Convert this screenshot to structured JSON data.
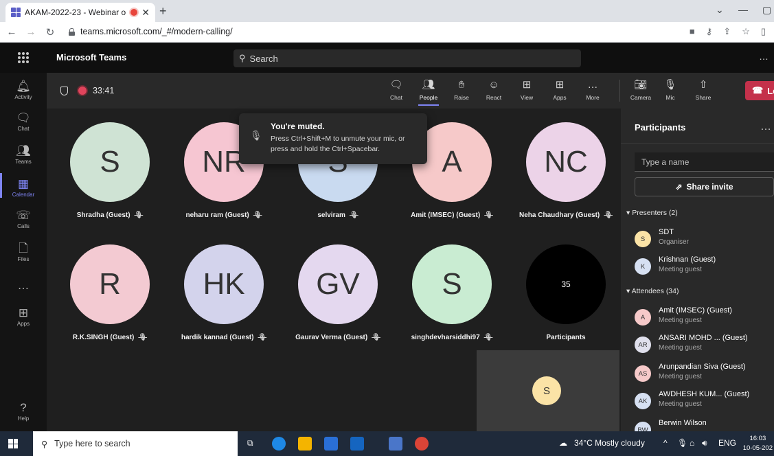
{
  "browser": {
    "tab_title": "AKAM-2022-23 - Webinar o",
    "tab_close": "✕",
    "new_tab": "+",
    "url": "teams.microsoft.com/_#/modern-calling/"
  },
  "teams": {
    "app_name": "Microsoft Teams",
    "search_placeholder": "Search"
  },
  "rail": [
    {
      "label": "Activity",
      "icon": "bell-icon",
      "glyph": "🔔︎"
    },
    {
      "label": "Chat",
      "icon": "chat-icon",
      "glyph": "🗨︎"
    },
    {
      "label": "Teams",
      "icon": "teams-icon",
      "glyph": "👥︎"
    },
    {
      "label": "Calendar",
      "icon": "calendar-icon",
      "glyph": "▦",
      "active": true
    },
    {
      "label": "Calls",
      "icon": "phone-icon",
      "glyph": "☏"
    },
    {
      "label": "Files",
      "icon": "file-icon",
      "glyph": "🗋"
    },
    {
      "label": "",
      "icon": "more-icon",
      "glyph": "…"
    },
    {
      "label": "Apps",
      "icon": "apps-icon",
      "glyph": "⊞"
    },
    {
      "label": "Help",
      "icon": "help-icon",
      "glyph": "?"
    }
  ],
  "meeting": {
    "timer": "33:41",
    "controls": [
      {
        "label": "Chat",
        "icon": "chat-icon",
        "glyph": "🗨︎"
      },
      {
        "label": "People",
        "icon": "people-icon",
        "glyph": "👥︎",
        "active": true
      },
      {
        "label": "Raise",
        "icon": "raise-hand-icon",
        "glyph": "✋︎"
      },
      {
        "label": "React",
        "icon": "react-icon",
        "glyph": "☺"
      },
      {
        "label": "View",
        "icon": "view-icon",
        "glyph": "⊞"
      },
      {
        "label": "Apps",
        "icon": "apps-icon",
        "glyph": "⊞"
      },
      {
        "label": "More",
        "icon": "more-icon",
        "glyph": "…"
      },
      {
        "label": "Camera",
        "icon": "camera-off-icon",
        "glyph": "📷︎"
      },
      {
        "label": "Mic",
        "icon": "mic-off-icon",
        "glyph": "🎙︎"
      },
      {
        "label": "Share",
        "icon": "share-icon",
        "glyph": "⇧"
      }
    ],
    "leave_label": "Leave"
  },
  "toast": {
    "title": "You're muted.",
    "body": "Press Ctrl+Shift+M to unmute your mic, or press and hold the Ctrl+Spacebar."
  },
  "tiles": [
    {
      "initials": "S",
      "name": "Shradha (Guest)",
      "color": "#cfe3d4",
      "mic_off": true
    },
    {
      "initials": "NR",
      "name": "neharu ram (Guest)",
      "color": "#f6c6d2",
      "mic_off": true
    },
    {
      "initials": "S",
      "name": "selviram",
      "color": "#c9daf0",
      "mic_off": true
    },
    {
      "initials": "A",
      "name": "Amit (IMSEC) (Guest)",
      "color": "#f6c9c9",
      "mic_off": true
    },
    {
      "initials": "NC",
      "name": "Neha Chaudhary (Guest)",
      "color": "#ecd3e8",
      "mic_off": true
    },
    {
      "initials": "R",
      "name": "R.K.SINGH (Guest)",
      "color": "#f3cad2",
      "mic_off": true
    },
    {
      "initials": "HK",
      "name": "hardik kannad (Guest)",
      "color": "#d3d3ec",
      "mic_off": true
    },
    {
      "initials": "GV",
      "name": "Gaurav Verma (Guest)",
      "color": "#e4d8ef",
      "mic_off": true
    },
    {
      "initials": "S",
      "name": "singhdevharsiddhi97",
      "color": "#c9ecd2",
      "mic_off": true
    },
    {
      "initials": "35",
      "name": "Participants",
      "color": "#000000",
      "mic_off": false,
      "overflow": true
    }
  ],
  "self_view": {
    "initials": "S"
  },
  "participants": {
    "title": "Participants",
    "search_placeholder": "Type a name",
    "invite_label": "Share invite",
    "presenters_header": "Presenters (2)",
    "attendees_header": "Attendees (34)",
    "presenters": [
      {
        "initials": "S",
        "name": "SDT",
        "role": "Organiser",
        "color": "#fbe3a6"
      },
      {
        "initials": "K",
        "name": "Krishnan (Guest)",
        "role": "Meeting guest",
        "color": "#d6e0f2"
      }
    ],
    "attendees": [
      {
        "initials": "A",
        "name": "Amit (IMSEC) (Guest)",
        "role": "Meeting guest",
        "color": "#f6c9c9"
      },
      {
        "initials": "AR",
        "name": "ANSARI MOHD ... (Guest)",
        "role": "Meeting guest",
        "color": "#e0e0ec"
      },
      {
        "initials": "AS",
        "name": "Arunpandian Siva (Guest)",
        "role": "Meeting guest",
        "color": "#f6c9c9"
      },
      {
        "initials": "AK",
        "name": "AWDHESH KUM... (Guest)",
        "role": "Meeting guest",
        "color": "#d6e0f2"
      },
      {
        "initials": "BW",
        "name": "Berwin Wilson",
        "role": "",
        "color": "#d6e0f2"
      }
    ]
  },
  "taskbar": {
    "search_placeholder": "Type here to search",
    "weather": "34°C Mostly cloudy",
    "lang": "ENG",
    "time": "16:03",
    "date": "10-05-202"
  }
}
